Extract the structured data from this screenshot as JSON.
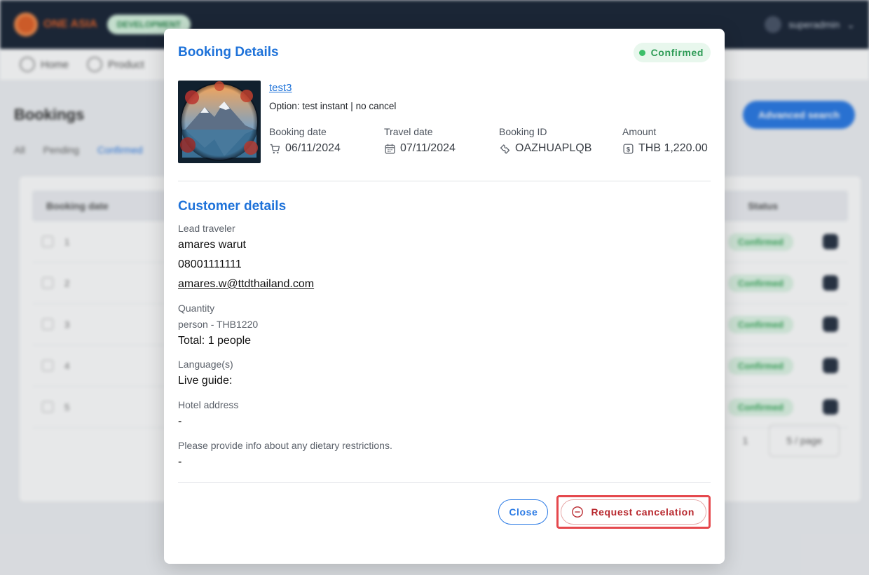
{
  "background": {
    "page_title": "Bookings",
    "advanced_search_label": "Advanced search",
    "tabs": [
      "All",
      "Pending",
      "Confirmed"
    ],
    "breadcrumb": [
      "Home",
      "Product"
    ],
    "table_headers": [
      "Booking date",
      "Status"
    ],
    "row_status": "Confirmed",
    "row_ids": [
      "1",
      "2",
      "3",
      "4",
      "5"
    ],
    "page_size_label": "5 / page",
    "user_name": "superadmin",
    "env_badge": "DEVELOPMENT",
    "brand": "ONE ASIA"
  },
  "modal": {
    "title": "Booking Details",
    "status": "Confirmed",
    "status_color": "#3dbf6a",
    "product": {
      "name": "test3",
      "option": "Option: test instant | no cancel"
    },
    "meta": [
      {
        "label": "Booking date",
        "value": "06/11/2024",
        "icon": "cart-icon"
      },
      {
        "label": "Travel date",
        "value": "07/11/2024",
        "icon": "calendar-icon"
      },
      {
        "label": "Booking ID",
        "value": "OAZHUAPLQB",
        "icon": "ticket-icon"
      },
      {
        "label": "Amount",
        "value": "THB 1,220.00",
        "icon": "dollar-icon"
      }
    ],
    "customer": {
      "section_title": "Customer details",
      "lead_label": "Lead traveler",
      "lead_name": "amares warut",
      "lead_phone": "08001111111",
      "lead_email": "amares.w@ttdthailand.com",
      "quantity_label": "Quantity",
      "quantity_detail": "person - THB1220",
      "quantity_total": "Total: 1 people",
      "language_label": "Language(s)",
      "language_value": "Live guide:",
      "hotel_label": "Hotel address",
      "hotel_value": "-",
      "dietary_label": "Please provide info about any dietary restrictions.",
      "dietary_value": "-"
    },
    "buttons": {
      "close": "Close",
      "request_cancel": "Request cancelation"
    },
    "accent_color": "#1e72d9",
    "danger_color": "#b8282e"
  }
}
